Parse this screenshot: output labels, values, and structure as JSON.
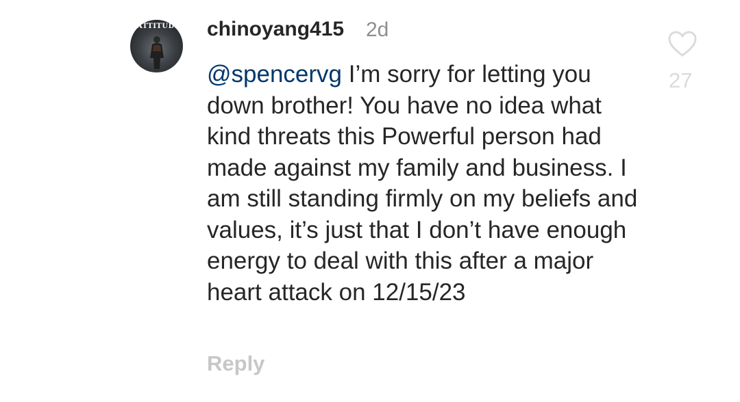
{
  "comment": {
    "avatar_text": "ATTITUDE",
    "username": "chinoyang415",
    "timestamp": "2d",
    "mention": "@spencervg",
    "text": " I’m sorry for letting you down brother! You have no idea what kind threats this Powerful person had made against my family and business. I am still standing firmly on my beliefs and values, it’s just that I don’t have enough energy to deal with this after a major heart attack on 12/15/23",
    "reply_label": "Reply",
    "like_count": "27",
    "like_icon": "heart-outline-icon"
  },
  "colors": {
    "text": "#262626",
    "mention": "#00376b",
    "muted": "#8e8e8e",
    "reply": "#c7c7c7",
    "like": "#dbdbdb"
  }
}
